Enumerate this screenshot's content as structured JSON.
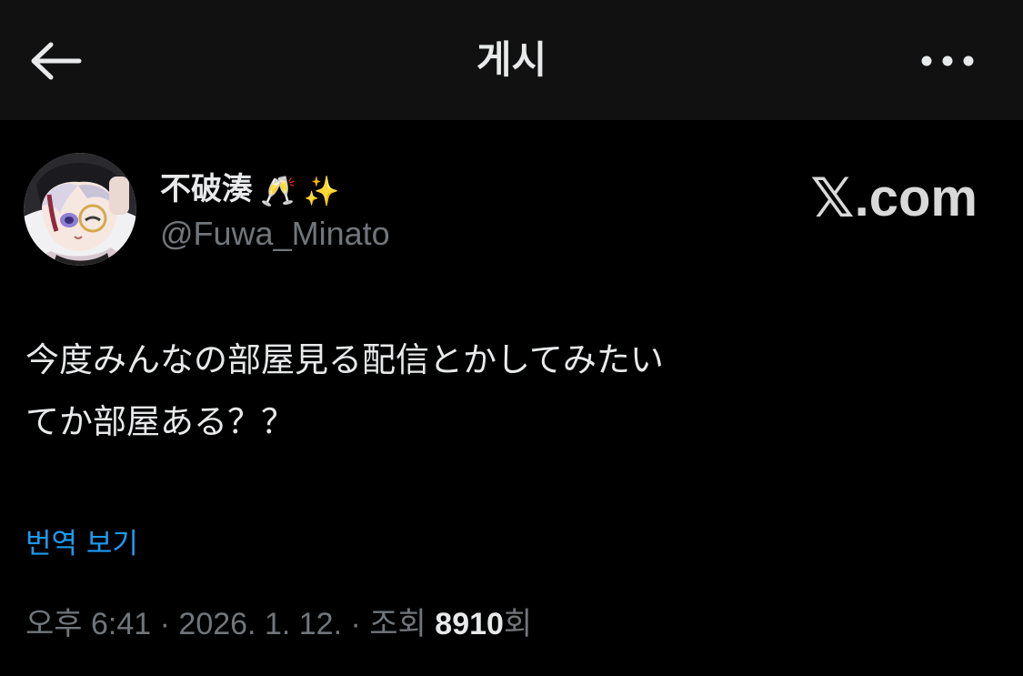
{
  "header": {
    "title": "게시",
    "back_icon": "arrow-left-icon",
    "more_icon": "more-horizontal-icon"
  },
  "author": {
    "display_name": "不破湊",
    "emojis": [
      "🥂",
      "✨"
    ],
    "handle": "@Fuwa_Minato"
  },
  "watermark": {
    "symbol": "𝕏",
    "suffix": ".com"
  },
  "post": {
    "lines": [
      "今度みんなの部屋見る配信とかしてみたい",
      "てか部屋ある？？"
    ],
    "translate_label": "번역 보기"
  },
  "meta": {
    "time": "오후 6:41",
    "separator": "·",
    "date": "2026. 1. 12.",
    "views_label": "조회",
    "views_count": "8910",
    "views_suffix": "회"
  },
  "colors": {
    "background": "#000000",
    "header_bg": "#111111",
    "text_primary": "#e7e9ea",
    "text_secondary": "#71767b",
    "link": "#1d9bf0"
  }
}
